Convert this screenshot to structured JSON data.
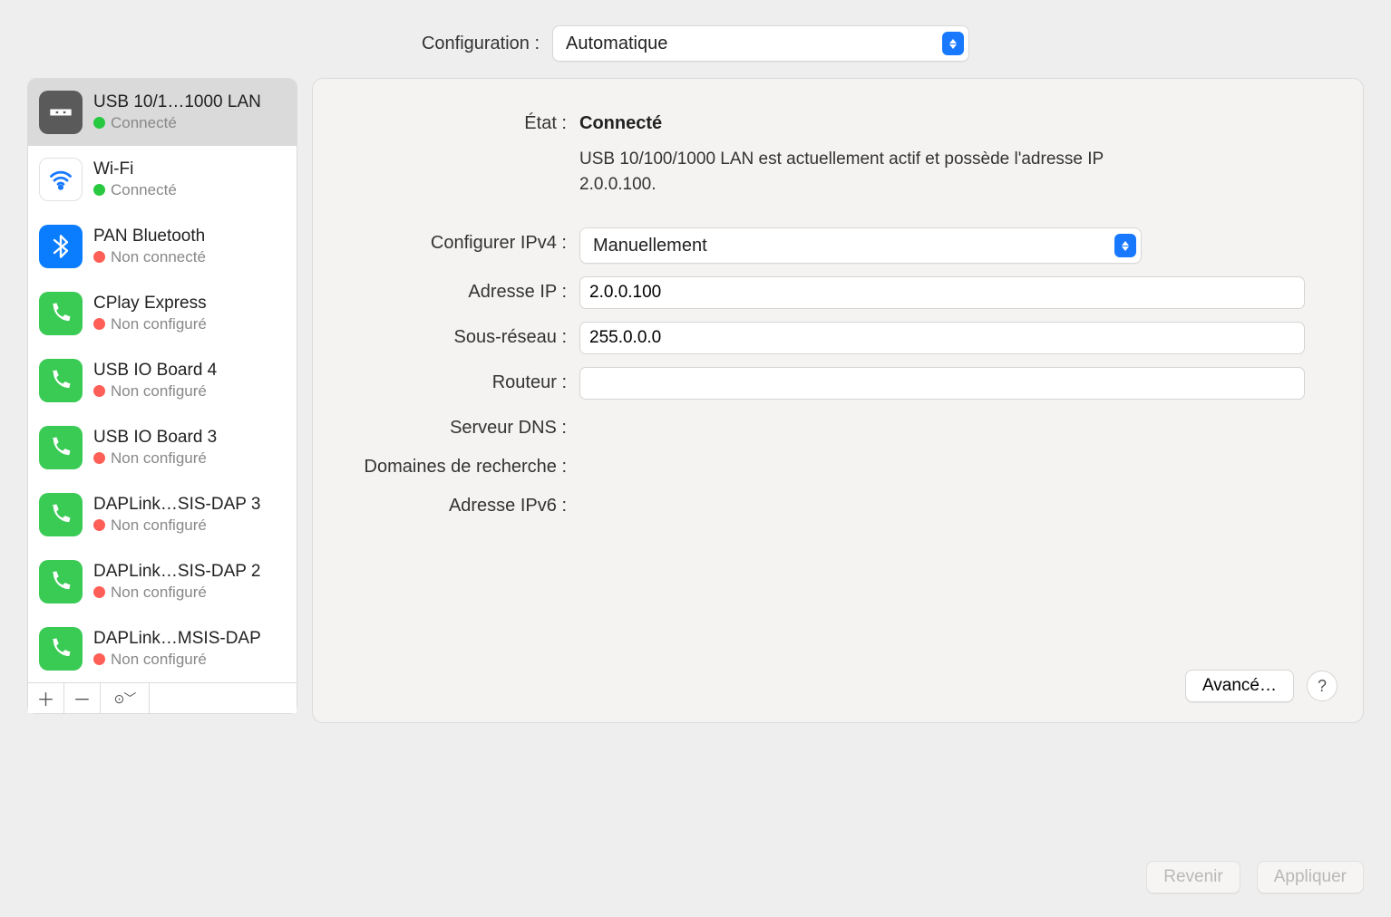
{
  "header": {
    "config_label": "Configuration :",
    "config_value": "Automatique"
  },
  "sidebar": {
    "items": [
      {
        "name": "USB 10/1…1000 LAN",
        "status": "Connecté",
        "dot": "green",
        "icon": "ethernet",
        "selected": true
      },
      {
        "name": "Wi-Fi",
        "status": "Connecté",
        "dot": "green",
        "icon": "wifi"
      },
      {
        "name": "PAN Bluetooth",
        "status": "Non connecté",
        "dot": "red",
        "icon": "bluetooth"
      },
      {
        "name": "CPlay Express",
        "status": "Non configuré",
        "dot": "red",
        "icon": "phone"
      },
      {
        "name": "USB IO Board       4",
        "status": "Non configuré",
        "dot": "red",
        "icon": "phone"
      },
      {
        "name": "USB IO Board       3",
        "status": "Non configuré",
        "dot": "red",
        "icon": "phone"
      },
      {
        "name": "DAPLink…SIS-DAP 3",
        "status": "Non configuré",
        "dot": "red",
        "icon": "phone"
      },
      {
        "name": "DAPLink…SIS-DAP 2",
        "status": "Non configuré",
        "dot": "red",
        "icon": "phone"
      },
      {
        "name": "DAPLink…MSIS-DAP",
        "status": "Non configuré",
        "dot": "red",
        "icon": "phone"
      }
    ]
  },
  "detail": {
    "state_label": "État :",
    "state_value": "Connecté",
    "state_desc": "USB 10/100/1000 LAN est actuellement actif et possède l'adresse IP 2.0.0.100.",
    "ipv4cfg_label": "Configurer IPv4 :",
    "ipv4cfg_value": "Manuellement",
    "ip_label": "Adresse IP :",
    "ip_value": "2.0.0.100",
    "subnet_label": "Sous-réseau :",
    "subnet_value": "255.0.0.0",
    "router_label": "Routeur :",
    "router_value": "",
    "dns_label": "Serveur DNS :",
    "search_label": "Domaines de recherche :",
    "ipv6_label": "Adresse IPv6 :",
    "advanced_label": "Avancé…"
  },
  "footer": {
    "revert": "Revenir",
    "apply": "Appliquer"
  }
}
